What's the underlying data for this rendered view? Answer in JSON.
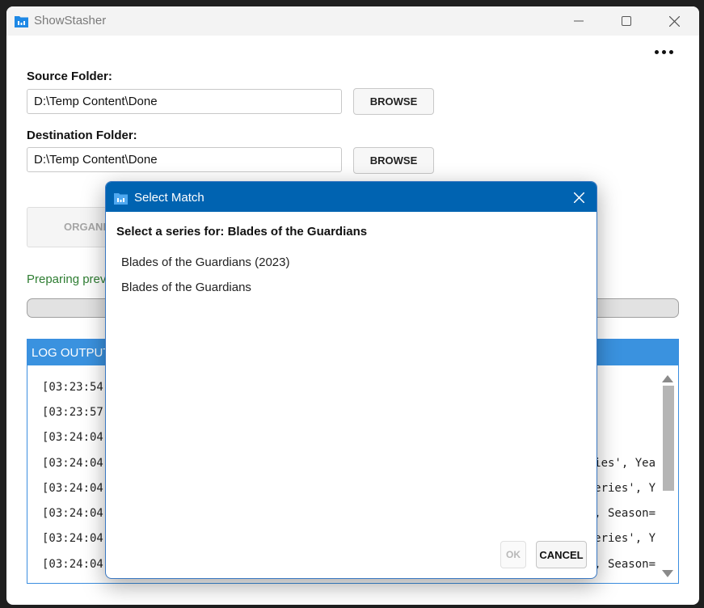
{
  "window": {
    "title": "ShowStasher"
  },
  "source": {
    "label": "Source Folder:",
    "value": "D:\\Temp Content\\Done",
    "browse_label": "BROWSE"
  },
  "destination": {
    "label": "Destination Folder:",
    "value": "D:\\Temp Content\\Done",
    "browse_label": "BROWSE"
  },
  "organize": {
    "label": "ORGANIZ"
  },
  "status": {
    "text": "Preparing prev"
  },
  "log": {
    "header": "LOG OUTPUT",
    "lines": [
      {
        "time": "[03:23:54",
        "tail": ""
      },
      {
        "time": "[03:23:57",
        "tail": ""
      },
      {
        "time": "[03:24:04",
        "tail": ""
      },
      {
        "time": "[03:24:04",
        "tail": "ies', Yea"
      },
      {
        "time": "[03:24:04",
        "tail": "eries', Y"
      },
      {
        "time": "[03:24:04",
        "tail": ", Season="
      },
      {
        "time": "[03:24:04",
        "tail": "eries', Y"
      },
      {
        "time": "[03:24:04",
        "tail": ", Season="
      }
    ]
  },
  "dialog": {
    "title": "Select Match",
    "prompt": "Select a series for: Blades of the Guardians",
    "options": [
      "Blades of the Guardians (2023)",
      "Blades of the Guardians"
    ],
    "ok_label": "OK",
    "cancel_label": "CANCEL"
  },
  "colors": {
    "accent": "#0063b1",
    "log_header": "#3a92df",
    "status": "#2e7d32"
  },
  "icons": [
    "app-icon",
    "minimize-icon",
    "maximize-icon",
    "close-icon",
    "more-options-icon"
  ]
}
